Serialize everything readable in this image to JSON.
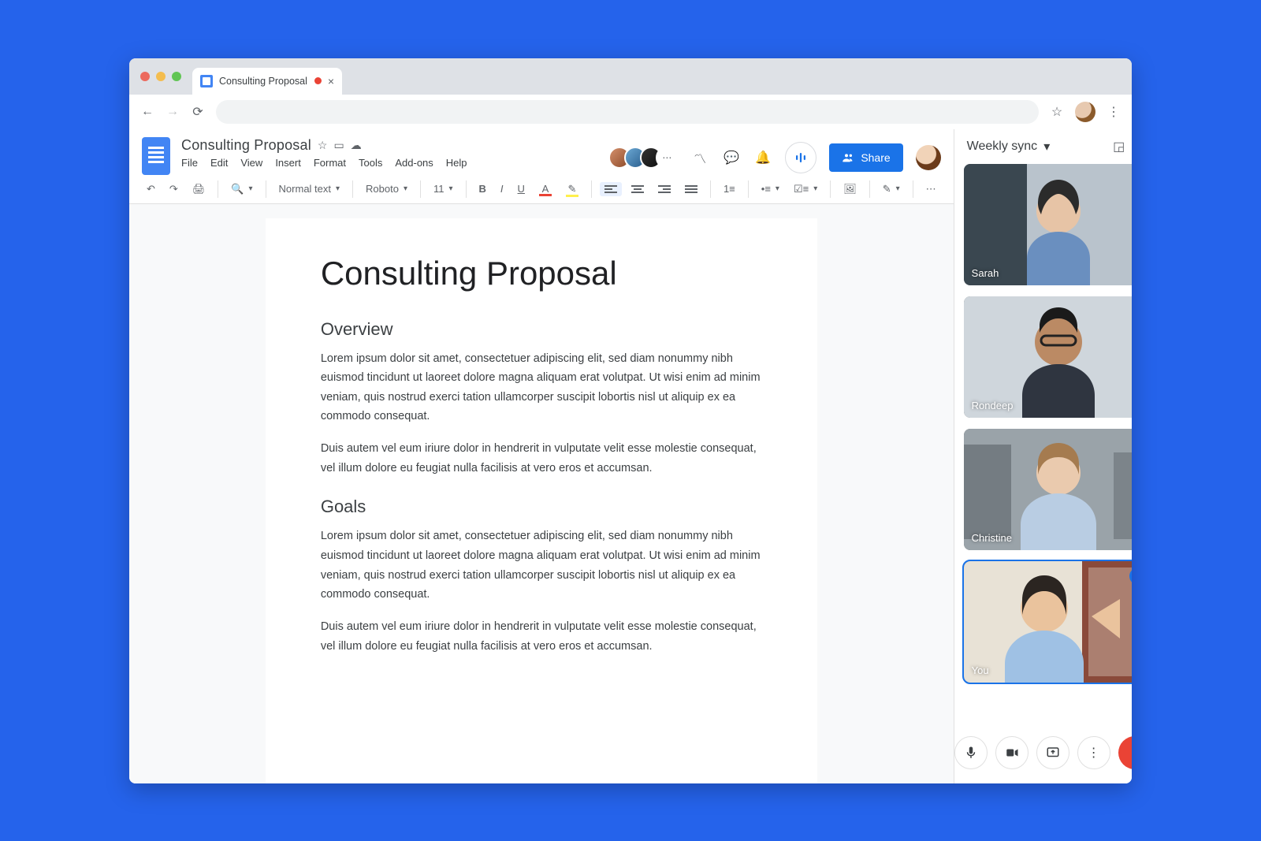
{
  "browser": {
    "tab_title": "Consulting Proposal"
  },
  "header": {
    "title": "Consulting Proposal",
    "menu": [
      "File",
      "Edit",
      "View",
      "Insert",
      "Format",
      "Tools",
      "Add-ons",
      "Help"
    ],
    "share_label": "Share"
  },
  "toolbar": {
    "style": "Normal text",
    "font": "Roboto",
    "size": "11"
  },
  "document": {
    "h1": "Consulting Proposal",
    "sec1_h": "Overview",
    "sec1_p1": "Lorem ipsum dolor sit amet, consectetuer adipiscing elit, sed diam nonummy nibh euismod tincidunt ut laoreet dolore magna aliquam erat volutpat. Ut wisi enim ad minim veniam, quis nostrud exerci tation ullamcorper suscipit lobortis nisl ut aliquip ex ea commodo consequat.",
    "sec1_p2": "Duis autem vel eum iriure dolor in hendrerit in vulputate velit esse molestie consequat, vel illum dolore eu feugiat nulla facilisis at vero eros et accumsan.",
    "sec2_h": "Goals",
    "sec2_p1": "Lorem ipsum dolor sit amet, consectetuer adipiscing elit, sed diam nonummy nibh euismod tincidunt ut laoreet dolore magna aliquam erat volutpat. Ut wisi enim ad minim veniam, quis nostrud exerci tation ullamcorper suscipit lobortis nisl ut aliquip ex ea commodo consequat.",
    "sec2_p2": "Duis autem vel eum iriure dolor in hendrerit in vulputate velit esse molestie consequat, vel illum dolore eu feugiat nulla facilisis at vero eros et accumsan."
  },
  "meet": {
    "title": "Weekly sync",
    "participants": [
      {
        "name": "Sarah"
      },
      {
        "name": "Rondeep"
      },
      {
        "name": "Christine"
      },
      {
        "name": "You"
      }
    ]
  }
}
